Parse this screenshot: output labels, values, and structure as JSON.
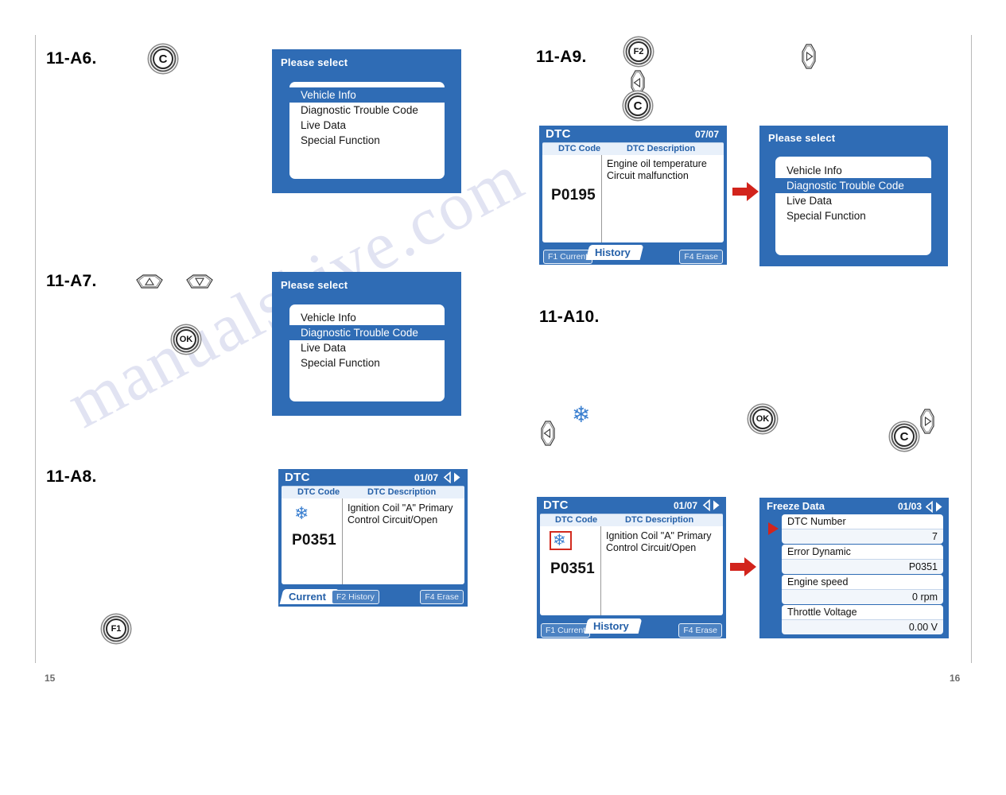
{
  "document": {
    "page_left": "15",
    "page_right": "16",
    "watermark": "manualshive.com"
  },
  "steps": [
    {
      "id": "a6",
      "label": "11-A6."
    },
    {
      "id": "a7",
      "label": "11-A7."
    },
    {
      "id": "a8",
      "label": "11-A8."
    },
    {
      "id": "a9",
      "label": "11-A9."
    },
    {
      "id": "a10",
      "label": "11-A10."
    }
  ],
  "keys": {
    "c": "C",
    "ok": "OK",
    "f1": "F1",
    "f2": "F2",
    "up": "up-arrow-key",
    "down": "down-arrow-key",
    "left": "left-arrow-key",
    "right": "right-arrow-key",
    "snowflake": "snowflake-icon"
  },
  "menu_screen": {
    "title": "Please select",
    "items": [
      "Vehicle Info",
      "Diagnostic Trouble Code",
      "Live Data",
      "Special Function"
    ],
    "selected_a6": "Vehicle Info",
    "selected_a7": "Diagnostic Trouble Code",
    "selected_a9": "Diagnostic Trouble Code"
  },
  "dtc_screen_a8": {
    "title": "DTC",
    "page": "01/07",
    "col_code": "DTC Code",
    "col_desc": "DTC Description",
    "code": "P0351",
    "description": "Ignition Coil \"A\" Primary\nControl Circuit/Open",
    "tab_active": "Current",
    "tab_other": "F2 History",
    "btn_erase": "F4 Erase",
    "has_snowflake": true,
    "snowflake_boxed": false
  },
  "dtc_screen_a9": {
    "title": "DTC",
    "page": "07/07",
    "col_code": "DTC Code",
    "col_desc": "DTC Description",
    "code": "P0195",
    "description": "Engine oil temperature\nCircuit malfunction",
    "tab_active": "History",
    "tab_other": "F1 Current",
    "btn_erase": "F4 Erase",
    "has_snowflake": false,
    "snowflake_boxed": false
  },
  "dtc_screen_a10": {
    "title": "DTC",
    "page": "01/07",
    "col_code": "DTC Code",
    "col_desc": "DTC Description",
    "code": "P0351",
    "description": "Ignition Coil \"A\" Primary\nControl Circuit/Open",
    "tab_active": "History",
    "tab_other": "F1 Current",
    "btn_erase": "F4 Erase",
    "has_snowflake": true,
    "snowflake_boxed": true
  },
  "freeze_screen": {
    "title": "Freeze Data",
    "page": "01/03",
    "rows": [
      {
        "name": "DTC Number",
        "value": "7"
      },
      {
        "name": "Error Dynamic",
        "value": "P0351"
      },
      {
        "name": "Engine speed",
        "value": "0 rpm"
      },
      {
        "name": "Throttle Voltage",
        "value": "0.00 V"
      }
    ]
  },
  "colors": {
    "screen_blue": "#2f6cb5",
    "header_blue": "#2560a8",
    "highlight_blue": "#2f6cb5",
    "arrow_red": "#d2241c",
    "snow_blue": "#3a7fd0",
    "box_red": "#d22b1f"
  }
}
